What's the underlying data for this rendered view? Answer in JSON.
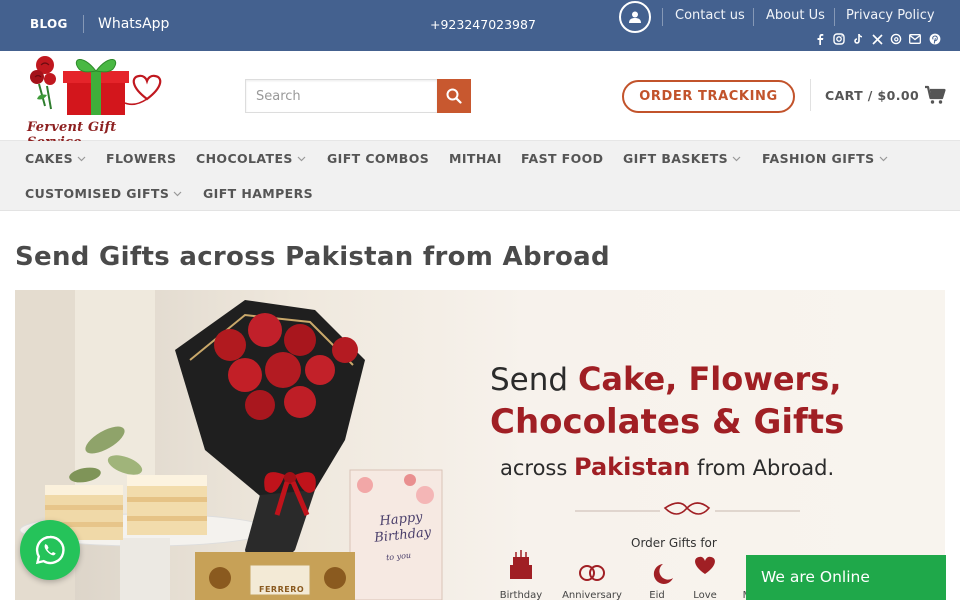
{
  "topbar": {
    "blog": "BLOG",
    "whatsapp": "WhatsApp",
    "phone": "+923247023987",
    "links": [
      "Contact us",
      "About Us",
      "Privacy Policy"
    ],
    "social_icons": [
      "facebook-icon",
      "instagram-icon",
      "tiktok-icon",
      "x-icon",
      "threads-icon",
      "email-icon",
      "pinterest-icon"
    ],
    "background": "#44618f"
  },
  "header": {
    "logo_text": "Fervent Gift Service",
    "search_placeholder": "Search",
    "order_tracking": "ORDER TRACKING",
    "cart": "CART / $0.00",
    "accent": "#c8582f"
  },
  "nav": {
    "items": [
      {
        "label": "CAKES",
        "dropdown": true
      },
      {
        "label": "FLOWERS",
        "dropdown": false
      },
      {
        "label": "CHOCOLATES",
        "dropdown": true
      },
      {
        "label": "GIFT COMBOS",
        "dropdown": false
      },
      {
        "label": "MITHAI",
        "dropdown": false
      },
      {
        "label": "FAST FOOD",
        "dropdown": false
      },
      {
        "label": "GIFT BASKETS",
        "dropdown": true
      },
      {
        "label": "FASHION GIFTS",
        "dropdown": true
      },
      {
        "label": "CUSTOMISED GIFTS",
        "dropdown": true
      },
      {
        "label": "GIFT HAMPERS",
        "dropdown": false
      }
    ]
  },
  "main": {
    "title": "Send Gifts across Pakistan from Abroad",
    "banner": {
      "line1_pre": "Send ",
      "line1_hl": "Cake, Flowers,",
      "line2": "Chocolates & Gifts",
      "line3_pre": "across ",
      "line3_hl": "Pakistan",
      "line3_post": " from Abroad.",
      "order_for": "Order Gifts for",
      "occasions": [
        "Birthday",
        "Anniversary",
        "Eid",
        "Love",
        "M"
      ],
      "card_text": "Happy Birthday",
      "card_sub": "to you",
      "box_text": "FERRERO"
    }
  },
  "floating": {
    "online": "We are Online",
    "whatsapp_color": "#25c35a",
    "online_color": "#1fa84a"
  }
}
